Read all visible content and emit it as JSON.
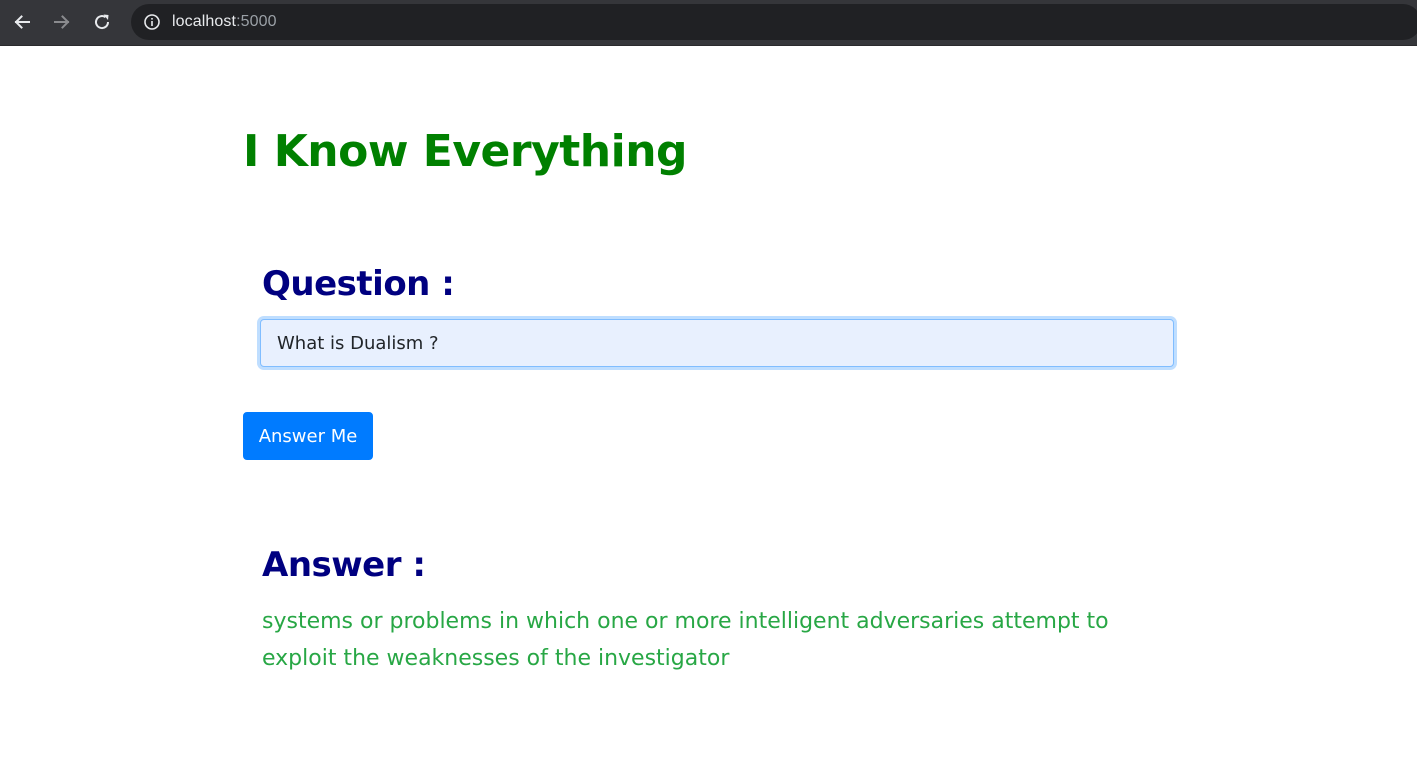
{
  "browser": {
    "url_host": "localhost",
    "url_port": ":5000",
    "icons": {
      "back": "back-arrow-icon",
      "forward": "forward-arrow-icon",
      "reload": "reload-icon",
      "site_info": "info-icon"
    }
  },
  "page": {
    "title": "I Know Everything",
    "question_heading": "Question :",
    "question_value": "What is Dualism ?",
    "submit_label": "Answer Me",
    "answer_heading": "Answer :",
    "answer_text": "systems or problems in which one or more intelligent adversaries attempt to exploit the weaknesses of the investigator"
  },
  "colors": {
    "title": "#008000",
    "headings": "#000080",
    "answer_text": "#28a745",
    "button": "#007bff",
    "input_bg": "#e8f0fe"
  }
}
